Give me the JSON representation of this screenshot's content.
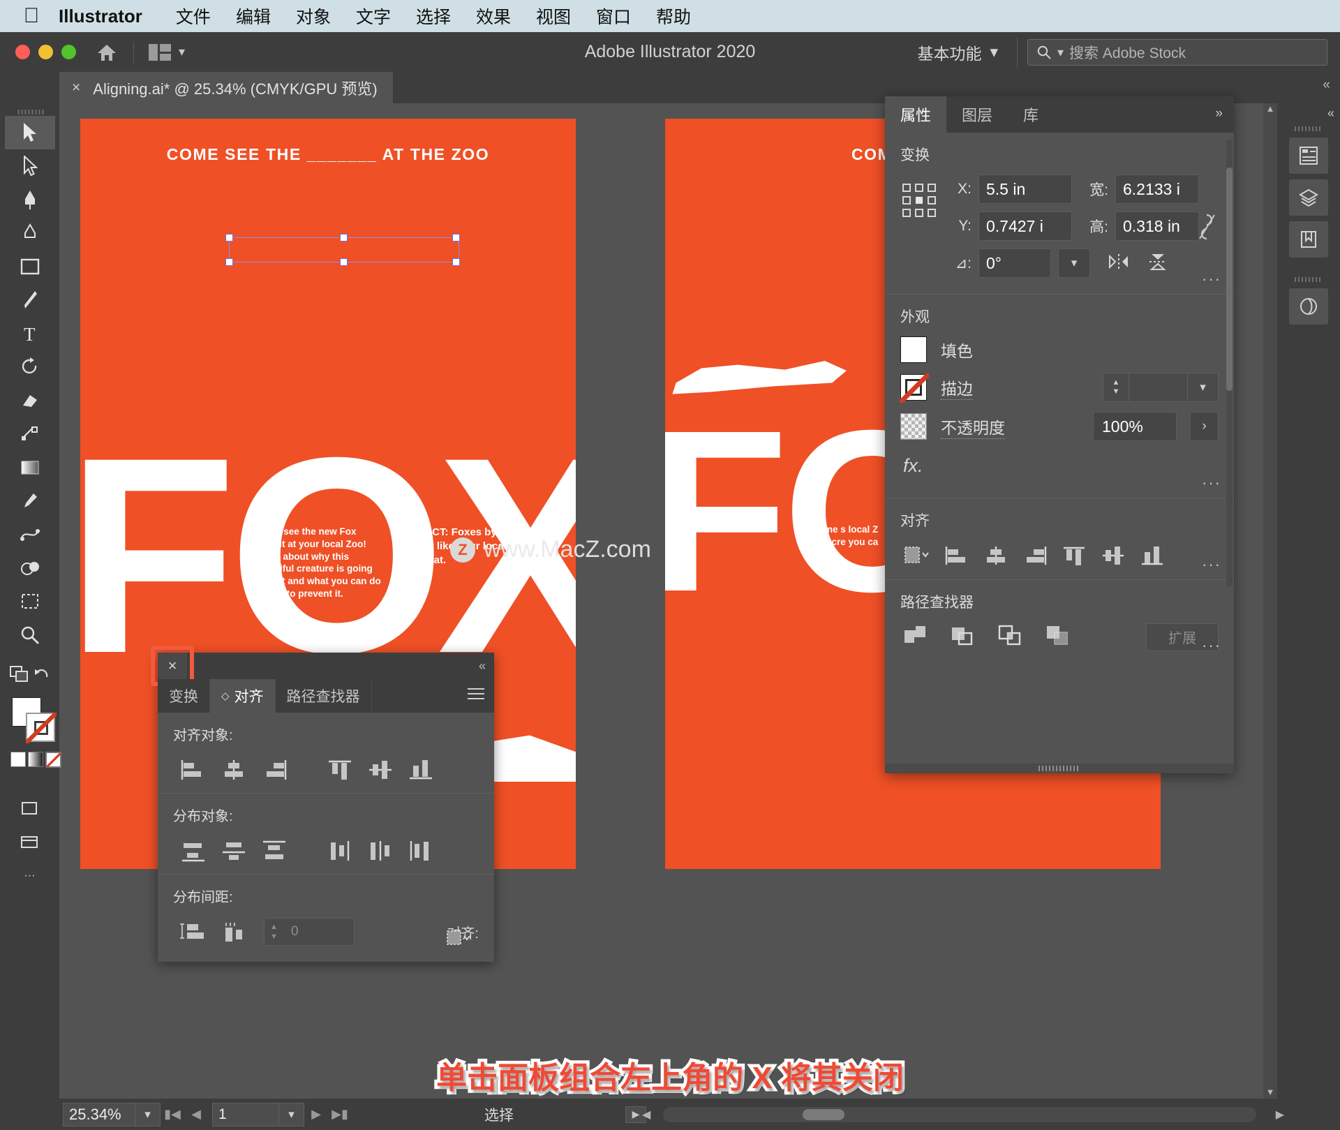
{
  "macbar": {
    "app_name": "Illustrator",
    "apple_icon": "apple-icon",
    "menus": [
      "文件",
      "编辑",
      "对象",
      "文字",
      "选择",
      "效果",
      "视图",
      "窗口",
      "帮助"
    ]
  },
  "titlebar": {
    "window_title": "Adobe Illustrator 2020",
    "workspace": "基本功能",
    "search_placeholder": "搜索 Adobe Stock",
    "home_icon": "home-icon",
    "arrange_icon": "arrange-documents-icon"
  },
  "document_tab": {
    "close_label": "×",
    "title": "Aligning.ai* @ 25.34% (CMYK/GPU 预览)"
  },
  "toolbar": {
    "tools": [
      {
        "name": "selection-tool",
        "glyph": "selection"
      },
      {
        "name": "direct-selection-tool",
        "glyph": "direct"
      },
      {
        "name": "pen-tool",
        "glyph": "pen"
      },
      {
        "name": "curvature-tool",
        "glyph": "curvature"
      },
      {
        "name": "rectangle-tool",
        "glyph": "rect"
      },
      {
        "name": "paintbrush-tool",
        "glyph": "brush"
      },
      {
        "name": "type-tool",
        "glyph": "type"
      },
      {
        "name": "rotate-tool",
        "glyph": "rotate"
      },
      {
        "name": "eraser-tool",
        "glyph": "eraser"
      },
      {
        "name": "scale-tool",
        "glyph": "scale"
      },
      {
        "name": "gradient-tool",
        "glyph": "gradient"
      },
      {
        "name": "eyedropper-tool",
        "glyph": "eyedropper"
      },
      {
        "name": "blend-tool",
        "glyph": "blend"
      },
      {
        "name": "shape-builder-tool",
        "glyph": "shapebuilder"
      },
      {
        "name": "artboard-tool",
        "glyph": "artboard"
      },
      {
        "name": "zoom-tool",
        "glyph": "zoom"
      },
      {
        "name": "hand-tool",
        "glyph": "hand"
      }
    ],
    "more_tools_label": "···"
  },
  "canvas": {
    "artboard1": {
      "headline": "COME SEE THE _______ AT THE ZOO",
      "body": "Come see the new Fox exhibit at your local Zoo! Learn about why this beautiful creature is going extinct and what you can do locally to prevent it.",
      "fun_fact": "FUN FACT: Foxes by nature act a lot like your local house cat.",
      "big_word": "FOX"
    },
    "artboard2": {
      "headline": "COME SEE TH",
      "body": "Come s local Z tiful cre you ca",
      "big_word": "FOX"
    },
    "watermark": {
      "badge": "Z",
      "text": "www.MacZ.com"
    }
  },
  "align_panel": {
    "close_label": "×",
    "collapse_label": "«",
    "tabs": [
      {
        "label": "变换",
        "active": false
      },
      {
        "label": "对齐",
        "active": true,
        "marker": "◇"
      },
      {
        "label": "路径查找器",
        "active": false
      }
    ],
    "menu_icon": "panel-menu-icon",
    "align_objects_label": "对齐对象:",
    "distribute_objects_label": "分布对象:",
    "distribute_spacing_label": "分布间距:",
    "align_to_label": "对齐:",
    "spacing_value": "0",
    "align_object_buttons": [
      "align-left-edges",
      "align-horizontal-centers",
      "align-right-edges",
      "align-top-edges",
      "align-vertical-centers",
      "align-bottom-edges"
    ],
    "distribute_object_buttons": [
      "distribute-top-edges",
      "distribute-vertical-centers",
      "distribute-bottom-edges",
      "distribute-left-edges",
      "distribute-horizontal-centers",
      "distribute-right-edges"
    ],
    "distribute_spacing_buttons": [
      "distribute-vertical-space",
      "distribute-horizontal-space"
    ],
    "align_to_icon": "align-to-selection-icon"
  },
  "properties_panel": {
    "tabs": [
      {
        "label": "属性",
        "active": true
      },
      {
        "label": "图层",
        "active": false
      },
      {
        "label": "库",
        "active": false
      }
    ],
    "collapse_label": "»",
    "transform": {
      "title": "变换",
      "reference_icon": "reference-point-icon",
      "x_label": "X:",
      "x_value": "5.5 in",
      "y_label": "Y:",
      "y_value": "0.7427 i",
      "w_label": "宽:",
      "w_value": "6.2133 i",
      "h_label": "高:",
      "h_value": "0.318 in",
      "angle_label": "⊿:",
      "angle_value": "0°",
      "link_icon": "constrain-proportions-icon",
      "flip_horizontal_icon": "flip-horizontal-icon",
      "flip_vertical_icon": "flip-vertical-icon",
      "more_label": "···"
    },
    "appearance": {
      "title": "外观",
      "fill_label": "填色",
      "fill_color": "#ffffff",
      "stroke_label": "描边",
      "stroke_value": "",
      "opacity_label": "不透明度",
      "opacity_value": "100%",
      "fx_label": "fx.",
      "more_label": "···"
    },
    "align": {
      "title": "对齐",
      "align_to_icon": "align-to-selection-icon",
      "buttons": [
        "align-left-edges",
        "align-horizontal-centers",
        "align-right-edges",
        "align-top-edges",
        "align-vertical-centers",
        "align-bottom-edges"
      ],
      "more_label": "···"
    },
    "pathfinder": {
      "title": "路径查找器",
      "buttons": [
        "unite",
        "minus-front",
        "intersect",
        "exclude"
      ],
      "expand_label": "扩展",
      "more_label": "···"
    }
  },
  "right_rail": {
    "buttons": [
      {
        "name": "properties-rail-icon"
      },
      {
        "name": "layers-rail-icon"
      },
      {
        "name": "libraries-rail-icon"
      },
      {
        "name": "brushes-rail-icon"
      }
    ],
    "collapse_label": "«"
  },
  "statusbar": {
    "zoom_value": "25.34%",
    "zoom_dropdown_icon": "chevron-down-icon",
    "first_artboard_icon": "first-artboard-icon",
    "prev_artboard_icon": "prev-artboard-icon",
    "artboard_number": "1",
    "artboard_dropdown_icon": "chevron-down-icon",
    "next_artboard_icon": "next-artboard-icon",
    "last_artboard_icon": "last-artboard-icon",
    "status_text": "选择",
    "status_arrow_icon": "chevron-right-icon"
  },
  "caption": {
    "text": "单击面板组合左上角的 X 将其关闭"
  }
}
